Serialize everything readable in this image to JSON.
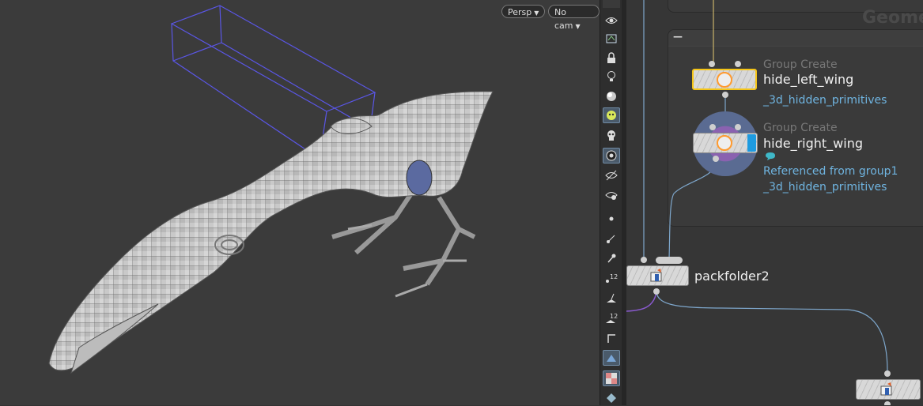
{
  "viewport": {
    "camera_label": "Persp",
    "cam_select_label": "No cam"
  },
  "toolbar": {
    "icons": [
      "eye-icon",
      "display-options-icon",
      "lock-icon",
      "light-bulb-icon",
      "shading-icon",
      "ghost-icon",
      "skull-icon",
      "gear-sphere-icon",
      "eye-slash-icon",
      "eye-cog-icon",
      "point-icon",
      "normal-icon",
      "pin-icon",
      "point-numbers-icon",
      "prim-normal-icon",
      "prim-numbers-icon",
      "corner-icon",
      "wireframe-shaded-icon",
      "checker-texture-icon",
      "cube-icon"
    ]
  },
  "network": {
    "header_title": "Geome",
    "collapse_label": "—",
    "nodes": [
      {
        "type": "Group Create",
        "name": "hide_left_wing",
        "lines": [
          "_3d_hidden_primitives"
        ]
      },
      {
        "type": "Group Create",
        "name": "hide_right_wing",
        "lines": [
          "Referenced from group1",
          "_3d_hidden_primitives"
        ]
      },
      {
        "name": "packfolder2"
      }
    ]
  },
  "colors": {
    "accent_selected": "#f5c518",
    "wire": "#7ea7cc",
    "label_blue": "#6fb4e0",
    "display_flag": "#1e9be0",
    "comment": "#3fb8c8"
  }
}
